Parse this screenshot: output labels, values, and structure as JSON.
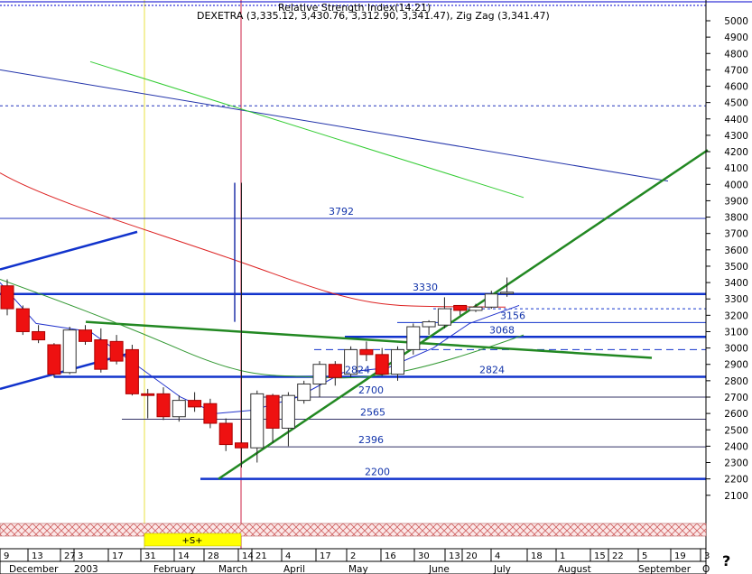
{
  "header": {
    "truncated_label": "Relative Strength Index(14.21)",
    "series_line": "DEXETRA (3,335.12, 3,430.76, 3,312.90, 3,341.47), Zig Zag (3,341.47)"
  },
  "help_label": "?",
  "chart_data": {
    "type": "candlestick",
    "ylim": [
      2050,
      5050
    ],
    "y_ticks": [
      2100,
      2200,
      2300,
      2400,
      2500,
      2600,
      2700,
      2800,
      2900,
      3000,
      3100,
      3200,
      3300,
      3400,
      3500,
      3600,
      3700,
      3800,
      3900,
      4000,
      4100,
      4200,
      4300,
      4400,
      4500,
      4600,
      4700,
      4800,
      4900,
      5000
    ],
    "x_week_labels": [
      "9",
      "13",
      "27",
      "3",
      "17",
      "31",
      "14",
      "28",
      "14",
      "21",
      "4",
      "17",
      "2",
      "16",
      "30",
      "13",
      "20",
      "4",
      "18",
      "1",
      "15",
      "22",
      "5",
      "19",
      "3"
    ],
    "x_month_labels": [
      "December",
      "2003",
      "February",
      "March",
      "April",
      "May",
      "June",
      "July",
      "August",
      "September",
      "O"
    ],
    "signal_marker": "+S+",
    "level_labels": [
      {
        "text": "3792",
        "value": 3792
      },
      {
        "text": "3330",
        "value": 3330
      },
      {
        "text": "3156",
        "value": 3156
      },
      {
        "text": "3068",
        "value": 3068
      },
      {
        "text": "2824",
        "value": 2824
      },
      {
        "text": "2824",
        "value": 2824
      },
      {
        "text": "2700",
        "value": 2700
      },
      {
        "text": "2565",
        "value": 2565
      },
      {
        "text": "2396",
        "value": 2396
      },
      {
        "text": "2200",
        "value": 2200
      }
    ],
    "candles": [
      {
        "o": 3380,
        "h": 3420,
        "l": 3200,
        "c": 3240
      },
      {
        "o": 3240,
        "h": 3260,
        "l": 3080,
        "c": 3100
      },
      {
        "o": 3100,
        "h": 3140,
        "l": 3030,
        "c": 3050
      },
      {
        "o": 3020,
        "h": 3030,
        "l": 2820,
        "c": 2840
      },
      {
        "o": 2850,
        "h": 3130,
        "l": 2840,
        "c": 3110
      },
      {
        "o": 3110,
        "h": 3140,
        "l": 3020,
        "c": 3040
      },
      {
        "o": 3050,
        "h": 3120,
        "l": 2850,
        "c": 2870
      },
      {
        "o": 3040,
        "h": 3080,
        "l": 2900,
        "c": 2920
      },
      {
        "o": 2990,
        "h": 3020,
        "l": 2710,
        "c": 2720
      },
      {
        "o": 2720,
        "h": 2750,
        "l": 2570,
        "c": 2710
      },
      {
        "o": 2720,
        "h": 2760,
        "l": 2560,
        "c": 2580
      },
      {
        "o": 2580,
        "h": 2710,
        "l": 2550,
        "c": 2680
      },
      {
        "o": 2680,
        "h": 2730,
        "l": 2610,
        "c": 2640
      },
      {
        "o": 2660,
        "h": 2690,
        "l": 2510,
        "c": 2540
      },
      {
        "o": 2540,
        "h": 2570,
        "l": 2370,
        "c": 2410
      },
      {
        "o": 2420,
        "h": 4010,
        "l": 2270,
        "c": 2390
      },
      {
        "o": 2390,
        "h": 2740,
        "l": 2300,
        "c": 2720
      },
      {
        "o": 2710,
        "h": 2720,
        "l": 2420,
        "c": 2510
      },
      {
        "o": 2510,
        "h": 2730,
        "l": 2400,
        "c": 2710
      },
      {
        "o": 2680,
        "h": 2800,
        "l": 2660,
        "c": 2780
      },
      {
        "o": 2780,
        "h": 2920,
        "l": 2700,
        "c": 2900
      },
      {
        "o": 2900,
        "h": 2920,
        "l": 2770,
        "c": 2820
      },
      {
        "o": 2840,
        "h": 3010,
        "l": 2820,
        "c": 2990
      },
      {
        "o": 2990,
        "h": 3040,
        "l": 2920,
        "c": 2960
      },
      {
        "o": 2960,
        "h": 3000,
        "l": 2830,
        "c": 2840
      },
      {
        "o": 2840,
        "h": 3010,
        "l": 2800,
        "c": 2990
      },
      {
        "o": 2990,
        "h": 3150,
        "l": 2960,
        "c": 3130
      },
      {
        "o": 3130,
        "h": 3170,
        "l": 3080,
        "c": 3160
      },
      {
        "o": 3140,
        "h": 3310,
        "l": 3120,
        "c": 3240
      },
      {
        "o": 3260,
        "h": 3260,
        "l": 3200,
        "c": 3230
      },
      {
        "o": 3230,
        "h": 3270,
        "l": 3220,
        "c": 3250
      },
      {
        "o": 3250,
        "h": 3350,
        "l": 3240,
        "c": 3330
      },
      {
        "o": 3335,
        "h": 3431,
        "l": 3313,
        "c": 3341
      }
    ]
  }
}
